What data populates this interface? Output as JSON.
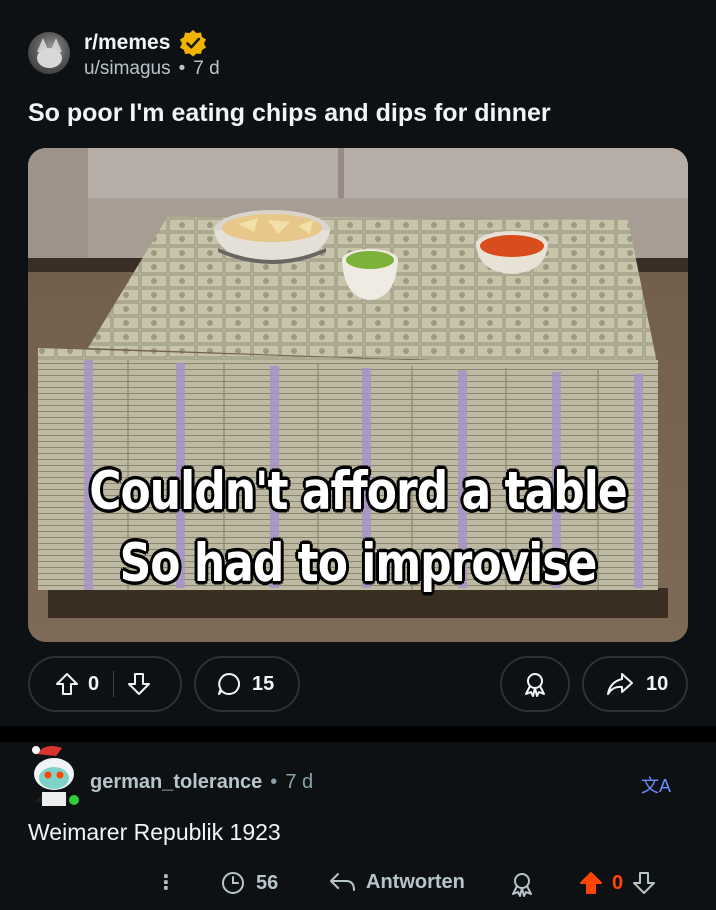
{
  "post": {
    "subreddit": "r/memes",
    "username": "u/simagus",
    "separator": "•",
    "age": "7 d",
    "title": "So poor I'm eating chips and dips for dinner",
    "image": {
      "caption_line1": "Couldn't afford a table",
      "caption_line2": "So had to improvise"
    },
    "actions": {
      "vote_count": "0",
      "comment_count": "15",
      "share_count": "10"
    }
  },
  "comment": {
    "author": "german_tolerance",
    "separator": "•",
    "age": "7 d",
    "translate_icon_label": "文A",
    "body": "Weimarer Republik 1923",
    "more_label": "⋮",
    "count": "56",
    "reply_label": "Antworten",
    "vote_count": "0"
  },
  "colors": {
    "background": "#0e1113",
    "text": "#f2f4f5",
    "muted": "#b7c4ca",
    "verified": "#f0b400",
    "upvote_active": "#ff4500",
    "translate": "#6b8cff",
    "online": "#2ecc40"
  }
}
